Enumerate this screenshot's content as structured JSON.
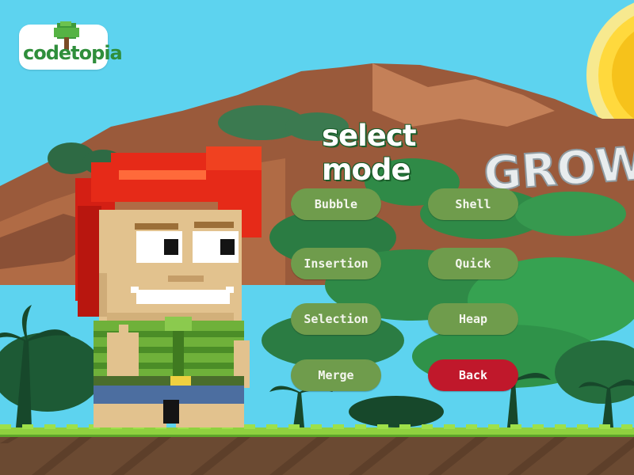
{
  "logo": {
    "text": "codetopia"
  },
  "header": {
    "title": "select mode"
  },
  "background": {
    "sign_text": "GROW"
  },
  "modes": {
    "bubble": "Bubble",
    "shell": "Shell",
    "insertion": "Insertion",
    "quick": "Quick",
    "selection": "Selection",
    "heap": "Heap",
    "merge": "Merge",
    "back": "Back"
  },
  "colors": {
    "sky": "#5dd3ef",
    "button_green": "#6f9c4c",
    "button_back": "#c0182b",
    "grass": "#8fd13f",
    "ground": "#6b4a32"
  }
}
